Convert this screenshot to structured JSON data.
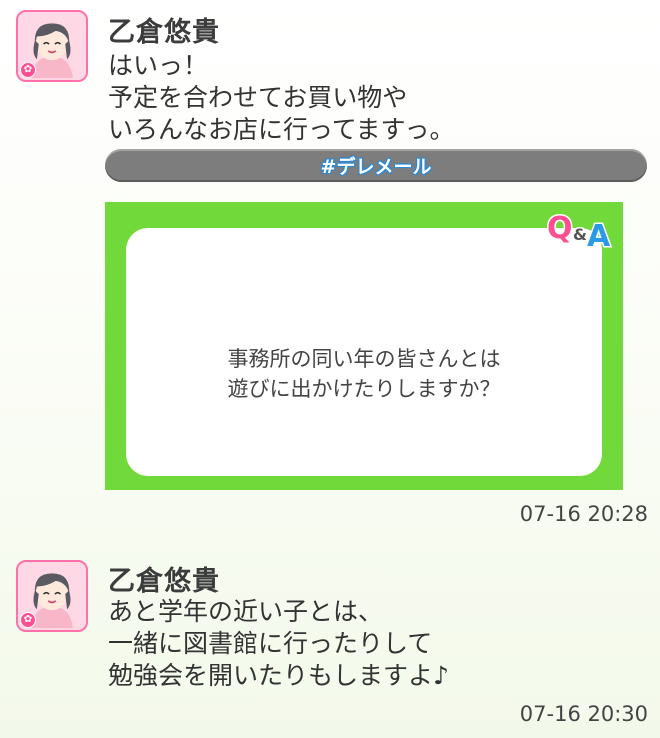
{
  "posts": [
    {
      "author": "乙倉悠貴",
      "avatar_icon": "idol-avatar-icon",
      "lines": [
        "はいっ！",
        "予定を合わせてお買い物や",
        "いろんなお店に行ってますっ。"
      ],
      "hashtag": "#デレメール",
      "qa": {
        "logo": "Q&A",
        "question_lines": [
          "事務所の同い年の皆さんとは",
          "遊びに出かけたりしますか？"
        ]
      },
      "timestamp": "07-16 20:28"
    },
    {
      "author": "乙倉悠貴",
      "avatar_icon": "idol-avatar-icon",
      "lines": [
        "あと学年の近い子とは、",
        "一緒に図書館に行ったりして",
        "勉強会を開いたりもしますよ♪"
      ],
      "timestamp": "07-16 20:30"
    }
  ],
  "colors": {
    "qa_card": "#72d93a",
    "tag_bar": "#7d7d7d",
    "avatar_border": "#ff6fa8",
    "qa_logo_q": "#ff4f93",
    "qa_logo_a": "#2a9ae6"
  }
}
